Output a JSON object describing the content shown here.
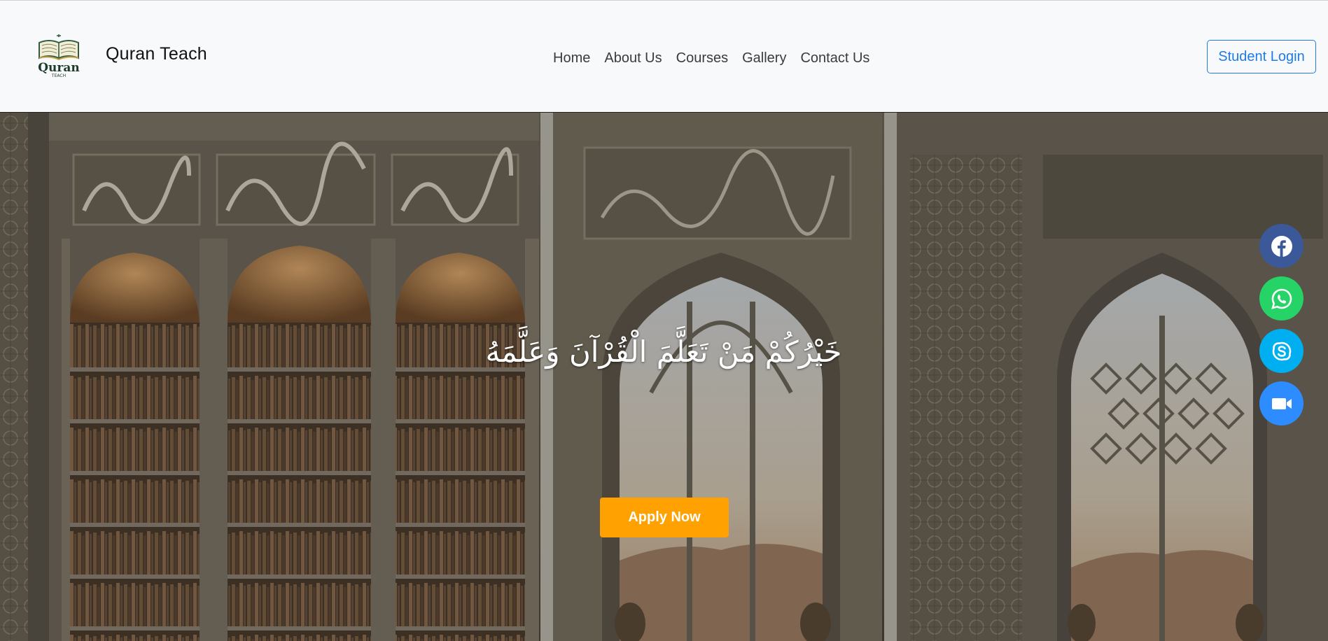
{
  "brand": {
    "name": "Quran Teach",
    "logo_word": "Quran",
    "logo_sub": "TEACH",
    "logo_icon": "open-book-logo"
  },
  "nav": {
    "links": [
      "Home",
      "About Us",
      "Courses",
      "Gallery",
      "Contact Us"
    ],
    "login_label": "Student Login"
  },
  "hero": {
    "verse": "خَيْرُكُمْ مَنْ تَعَلَّمَ الْقُرْآنَ وَعَلَّمَهُ",
    "apply_label": "Apply Now",
    "background": "islamic-library-interior-image"
  },
  "social": [
    {
      "name": "facebook",
      "icon": "facebook-icon",
      "color": "#3b5998"
    },
    {
      "name": "whatsapp",
      "icon": "whatsapp-icon",
      "color": "#25d366"
    },
    {
      "name": "skype",
      "icon": "skype-icon",
      "color": "#00aff0"
    },
    {
      "name": "zoom",
      "icon": "video-camera-icon",
      "color": "#2d8cff"
    }
  ],
  "colors": {
    "accent_blue": "#1e7be8",
    "apply_orange": "#ffa100",
    "navbar_bg": "#f8f9fa"
  }
}
